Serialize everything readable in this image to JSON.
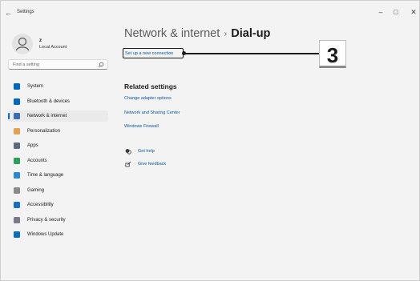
{
  "window": {
    "app_title": "Settings",
    "back_glyph": "←",
    "minimize_glyph": "–",
    "maximize_glyph": "□",
    "close_glyph": "✕"
  },
  "user": {
    "name": "z",
    "account": "Local Account"
  },
  "search": {
    "placeholder": "Find a setting"
  },
  "sidebar": {
    "items": [
      {
        "label": "System",
        "icon": "system-icon",
        "color": "#0067c0"
      },
      {
        "label": "Bluetooth & devices",
        "icon": "bluetooth-icon",
        "color": "#0067c0"
      },
      {
        "label": "Network & internet",
        "icon": "network-icon",
        "color": "#3a6fb0",
        "selected": true
      },
      {
        "label": "Personalization",
        "icon": "brush-icon",
        "color": "#e3a24f"
      },
      {
        "label": "Apps",
        "icon": "apps-icon",
        "color": "#5b6b80"
      },
      {
        "label": "Accounts",
        "icon": "accounts-icon",
        "color": "#2e9e5b"
      },
      {
        "label": "Time & language",
        "icon": "time-language-icon",
        "color": "#2b88d8"
      },
      {
        "label": "Gaming",
        "icon": "gaming-icon",
        "color": "#8a8a8a"
      },
      {
        "label": "Accessibility",
        "icon": "accessibility-icon",
        "color": "#1a6fc0"
      },
      {
        "label": "Privacy & security",
        "icon": "shield-icon",
        "color": "#7a7a8a"
      },
      {
        "label": "Windows Update",
        "icon": "update-icon",
        "color": "#0a6cc8"
      }
    ]
  },
  "main": {
    "breadcrumb_parent": "Network & internet",
    "breadcrumb_separator": "›",
    "breadcrumb_current": "Dial-up",
    "setup_link": "Set up a new connection",
    "related_heading": "Related settings",
    "related_links": [
      "Change adapter options",
      "Network and Sharing Center",
      "Windows Firewall"
    ],
    "help": {
      "get_help": "Get help",
      "give_feedback": "Give feedback"
    }
  },
  "callout": {
    "number": "3"
  },
  "colors": {
    "accent": "#0067c0",
    "link": "#0b57a6"
  }
}
